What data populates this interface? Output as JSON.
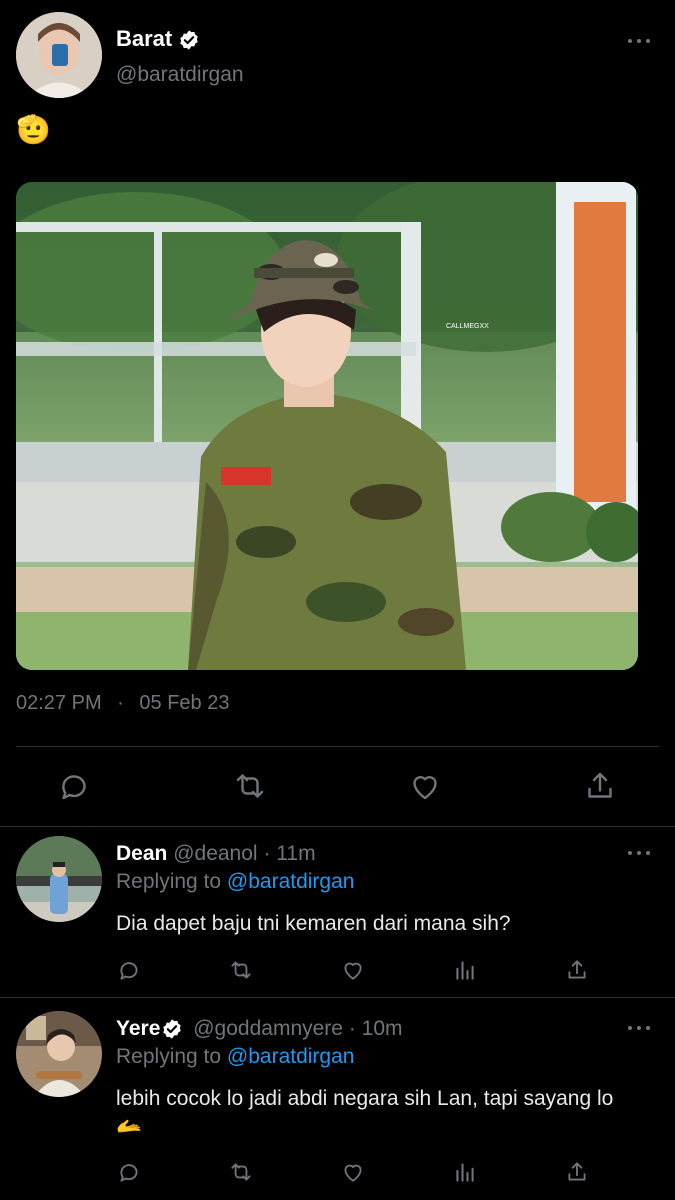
{
  "main_tweet": {
    "author_name": "Barat",
    "author_handle": "@baratdirgan",
    "text_emoji": "🫡",
    "media_watermark": "CALLMEGXX",
    "time": "02:27 PM",
    "separator": "·",
    "date": "05 Feb 23",
    "actions": [
      "reply-icon",
      "retweet-icon",
      "like-icon",
      "share-icon"
    ]
  },
  "replies": [
    {
      "author_name": "Dean",
      "author_handle": "@deanol",
      "time": "· 11m",
      "replying_label": "Replying to",
      "replying_to": "@baratdirgan",
      "text": "Dia dapet baju tni kemaren dari mana sih?",
      "verified": false
    },
    {
      "author_name": "Yere",
      "author_handle": "@goddamnyere",
      "time": "· 10m",
      "replying_label": "Replying to",
      "replying_to": "@baratdirgan",
      "text": "lebih cocok lo jadi abdi negara sih Lan, tapi sayang lo",
      "text_emoji": "🫴",
      "verified": true
    }
  ],
  "colors": {
    "background": "#000000",
    "text": "#e7e9ea",
    "muted": "#71767b",
    "link": "#1d9bf0",
    "divider": "#2f3336",
    "verified_badge": "#ffffff"
  }
}
